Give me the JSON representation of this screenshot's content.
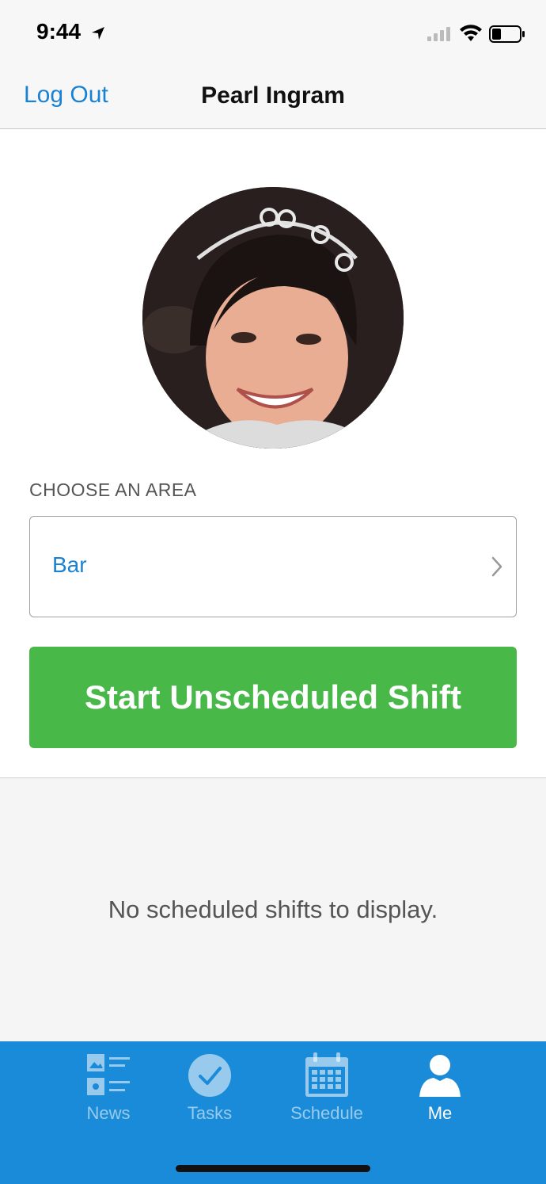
{
  "status_bar": {
    "time": "9:44"
  },
  "nav": {
    "logout_label": "Log Out",
    "title": "Pearl Ingram"
  },
  "profile": {
    "area_label": "CHOOSE AN AREA",
    "area_value": "Bar",
    "start_button_label": "Start Unscheduled Shift"
  },
  "empty_message": "No scheduled shifts to display.",
  "tabs": [
    {
      "label": "News",
      "icon": "news-icon"
    },
    {
      "label": "Tasks",
      "icon": "tasks-check-icon"
    },
    {
      "label": "Schedule",
      "icon": "calendar-icon"
    },
    {
      "label": "Me",
      "icon": "person-icon",
      "active": true
    }
  ],
  "colors": {
    "accent_blue": "#1a82d2",
    "button_green": "#48b949",
    "tab_bar_blue": "#1a8bd8"
  }
}
